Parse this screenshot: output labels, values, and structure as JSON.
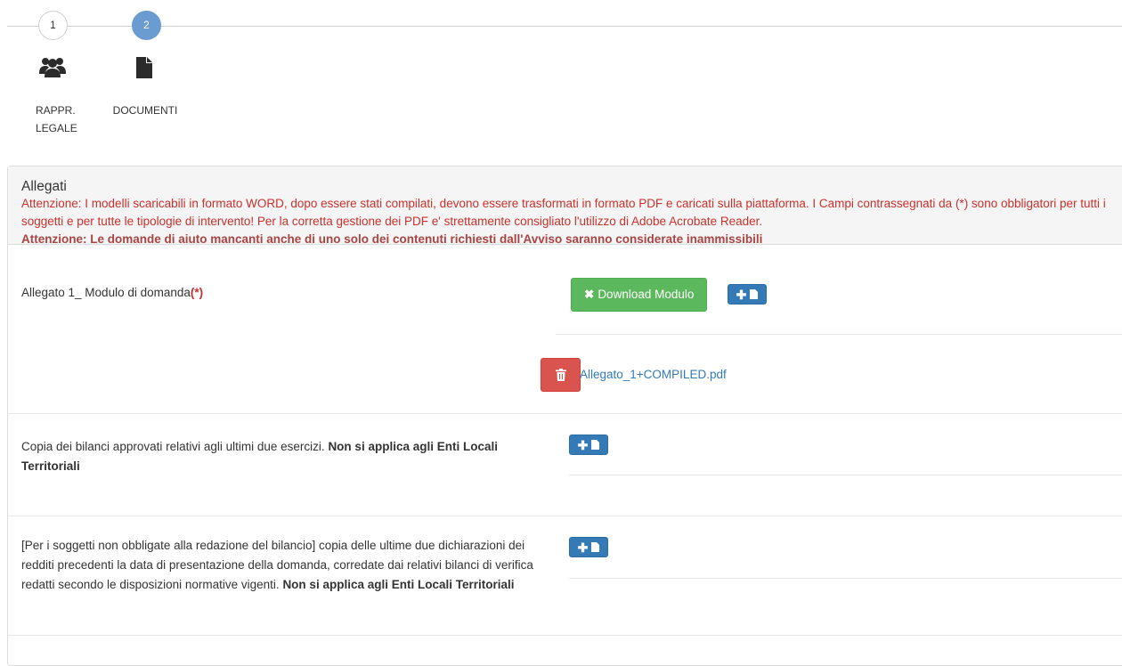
{
  "wizard": {
    "steps": [
      {
        "number": "1",
        "label_line1": "RAPPR.",
        "label_line2": "LEGALE",
        "icon": "users-icon",
        "state": "done"
      },
      {
        "number": "2",
        "label": "DOCUMENTI",
        "icon": "file-icon",
        "state": "active"
      }
    ]
  },
  "panel": {
    "title": "Allegati",
    "warning": "Attenzione: I modelli scaricabili in formato WORD, dopo essere stati compilati, devono essere trasformati in formato PDF e caricati sulla piattaforma. I Campi contrassegnati da (*) sono obbligatori per tutti i soggetti e per tutte le tipologie di intervento! Per la corretta gestione dei PDF e' strettamente consigliato l'utilizzo di Adobe Acrobate Reader.",
    "warning_bold": "Attenzione: Le domande di aiuto mancanti anche di uno solo dei contenuti richiesti dall'Avviso saranno considerate inammissibili"
  },
  "attachments": [
    {
      "label": "Allegato 1_ Modulo di domanda",
      "required_mark": "(*)",
      "download_label": "Download Modulo",
      "uploaded_file": "Allegato_1+COMPILED.pdf"
    },
    {
      "label": "Copia dei bilanci approvati relativi agli ultimi due esercizi.",
      "label_bold": "Non si applica agli Enti Locali Territoriali"
    },
    {
      "label": "[Per i soggetti non obbligate alla redazione del bilancio] copia delle ultime due dichiarazioni dei redditi precedenti la data di presentazione della domanda, corredate dai relativi bilanci di verifica redatti secondo le disposizioni normative vigenti.",
      "label_bold": "Non si applica agli Enti Locali Territoriali"
    }
  ],
  "colors": {
    "step_active": "#6a9bd1",
    "success": "#5cb85c",
    "primary": "#337ab7",
    "danger": "#d9534f",
    "warning_text": "#c9302c"
  }
}
